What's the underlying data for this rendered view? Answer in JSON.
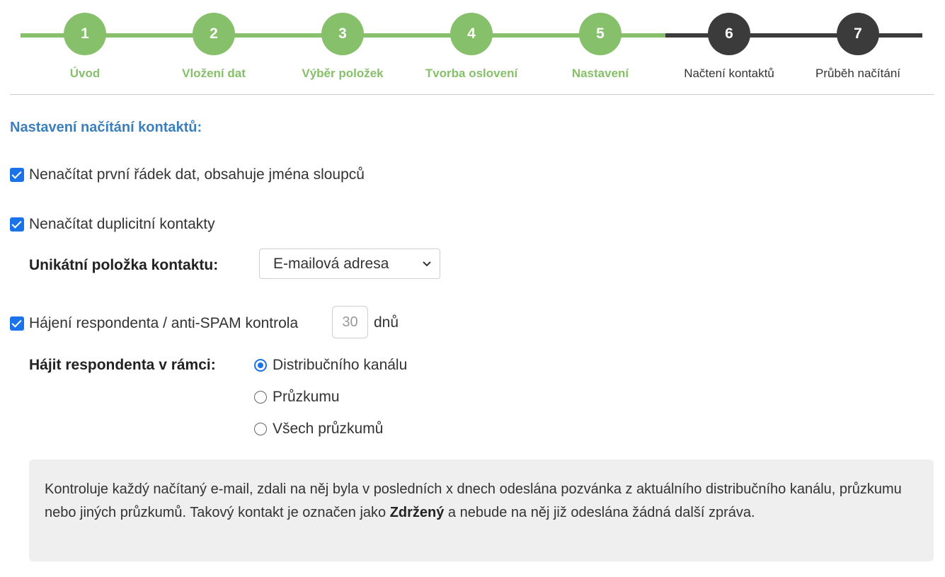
{
  "steps": [
    {
      "num": "1",
      "label": "Úvod",
      "state": "done"
    },
    {
      "num": "2",
      "label": "Vložení dat",
      "state": "done"
    },
    {
      "num": "3",
      "label": "Výběr položek",
      "state": "done"
    },
    {
      "num": "4",
      "label": "Tvorba oslovení",
      "state": "done"
    },
    {
      "num": "5",
      "label": "Nastavení",
      "state": "done"
    },
    {
      "num": "6",
      "label": "Načtení kontaktů",
      "state": "todo"
    },
    {
      "num": "7",
      "label": "Průběh načítání",
      "state": "todo"
    }
  ],
  "section_title": "Nastavení načítání kontaktů:",
  "options": {
    "skip_header": {
      "label": "Nenačítat první řádek dat, obsahuje jména sloupců",
      "checked": true
    },
    "skip_duplicates": {
      "label": "Nenačítat duplicitní kontakty",
      "checked": true
    },
    "unique_field_label": "Unikátní položka kontaktu:",
    "unique_field_value": "E-mailová adresa",
    "anti_spam": {
      "label": "Hájení respondenta / anti-SPAM kontrola",
      "checked": true
    },
    "days_value": "30",
    "days_unit": "dnů",
    "scope_label": "Hájit respondenta v rámci:",
    "scope_options": [
      {
        "label": "Distribučního kanálu",
        "selected": true
      },
      {
        "label": "Průzkumu",
        "selected": false
      },
      {
        "label": "Všech průzkumů",
        "selected": false
      }
    ]
  },
  "info": {
    "text_before": "Kontroluje každý načítaný e-mail, zdali na něj byla v posledních x dnech odeslána pozvánka z aktuálního distribučního kanálu, průzkumu nebo jiných průzkumů. Takový kontakt je označen jako ",
    "bold": "Zdržený",
    "text_after": " a nebude na něj již odeslána žádná další zpráva."
  },
  "colors": {
    "accent_green": "#86c06a",
    "dark_step": "#3b3b3b",
    "title_blue": "#3b7fbd",
    "checkbox_blue": "#1a73e8"
  }
}
